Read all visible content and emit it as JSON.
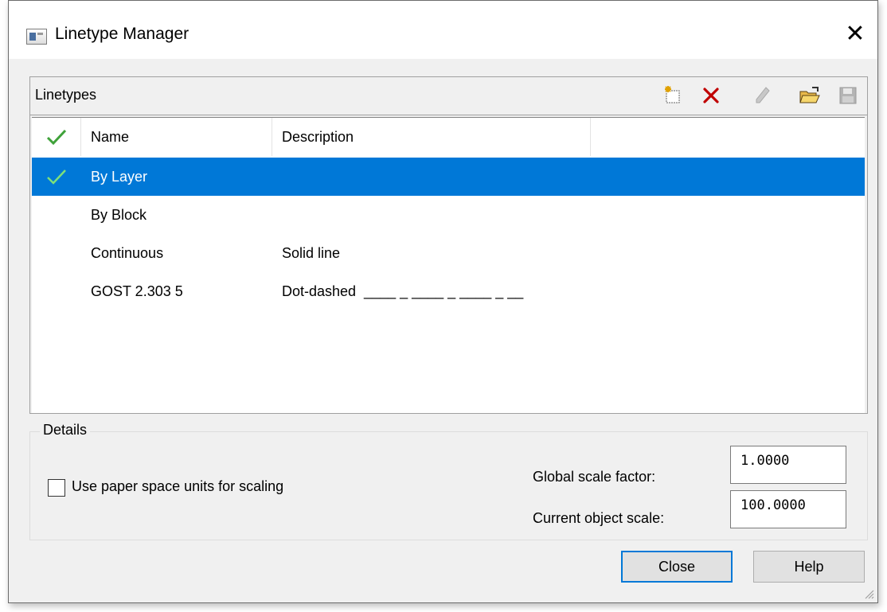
{
  "window": {
    "title": "Linetype Manager",
    "close_glyph": "✕"
  },
  "linetypes": {
    "title": "Linetypes",
    "toolbar": [
      {
        "icon": "new-linetype-icon"
      },
      {
        "icon": "delete-icon",
        "color": "#c00000"
      },
      {
        "icon": "edit-icon",
        "disabled": true
      },
      {
        "icon": "open-folder-icon"
      },
      {
        "icon": "save-icon",
        "disabled": true
      }
    ],
    "columns": {
      "current": "",
      "name": "Name",
      "description": "Description"
    },
    "rows": [
      {
        "name": "By Layer",
        "description": "",
        "current": true,
        "selected": true
      },
      {
        "name": "By Block",
        "description": ""
      },
      {
        "name": "Continuous",
        "description": "Solid line"
      },
      {
        "name": "GOST 2.303 5",
        "description": "Dot-dashed  ____ _ ____ _ ____ _ __"
      }
    ]
  },
  "details": {
    "title": "Details",
    "paper_space_label": "Use paper space units for scaling",
    "paper_space_checked": false,
    "global_scale_label": "Global scale factor:",
    "global_scale_value": "1.0000",
    "object_scale_label": "Current object scale:",
    "object_scale_value": "100.0000"
  },
  "buttons": {
    "close": "Close",
    "help": "Help"
  },
  "colors": {
    "selection": "#0078d7",
    "check": "#3fa23a",
    "delete": "#c00000"
  }
}
